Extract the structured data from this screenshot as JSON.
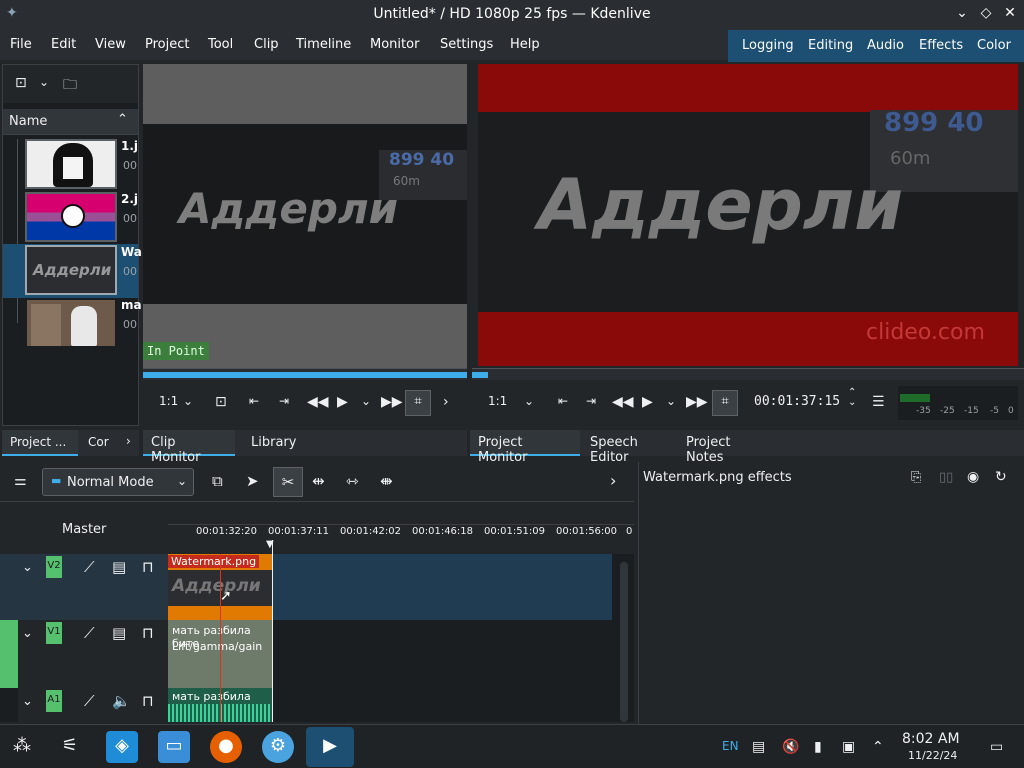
{
  "window": {
    "title": "Untitled* / HD 1080p 25 fps — Kdenlive"
  },
  "menu": [
    "File",
    "Edit",
    "View",
    "Project",
    "Tool",
    "Clip",
    "Timeline",
    "Monitor",
    "Settings",
    "Help"
  ],
  "layouts": [
    "Logging",
    "Editing",
    "Audio",
    "Effects",
    "Color"
  ],
  "bin": {
    "header": "Name",
    "items": [
      {
        "name": "1.j",
        "sub": "00"
      },
      {
        "name": "2.j",
        "sub": "00"
      },
      {
        "name": "Wa",
        "sub": "00"
      },
      {
        "name": "ma",
        "sub": "00"
      }
    ],
    "tabs": [
      "Project ...",
      "Cor"
    ]
  },
  "clip_monitor": {
    "overlay_text": "Аддерли",
    "overlay_num": "899  40",
    "overlay_sub": "60m",
    "in_point": "In Point",
    "zoom": "1:1",
    "tabs": [
      "Clip Monitor",
      "Library"
    ]
  },
  "project_monitor": {
    "overlay_text": "Аддерли",
    "overlay_num": "899  40",
    "overlay_sub": "60m",
    "watermark": "clideo.com",
    "zoom": "1:1",
    "timecode": "00:01:37:15",
    "vu_labels": [
      "-35",
      "-25",
      "-15",
      "-5",
      "0"
    ],
    "tabs": [
      "Project Monitor",
      "Speech Editor",
      "Project Notes"
    ]
  },
  "timeline": {
    "mode": "Normal Mode",
    "master": "Master",
    "ticks": [
      "00:01:32:20",
      "00:01:37:11",
      "00:01:42:02",
      "00:01:46:18",
      "00:01:51:09",
      "00:01:56:00",
      "0"
    ],
    "tracks": [
      {
        "label": "V2",
        "clip": "Watermark.png",
        "clip_text": "Аддерли"
      },
      {
        "label": "V1",
        "clip": "мать разбила бите",
        "clip_sub": "Lift/gamma/gain"
      },
      {
        "label": "A1",
        "clip": "мать разбила бите"
      }
    ]
  },
  "effects": {
    "title": "Watermark.png effects"
  },
  "taskbar": {
    "lang": "EN",
    "time": "8:02 AM",
    "date": "11/22/24"
  }
}
